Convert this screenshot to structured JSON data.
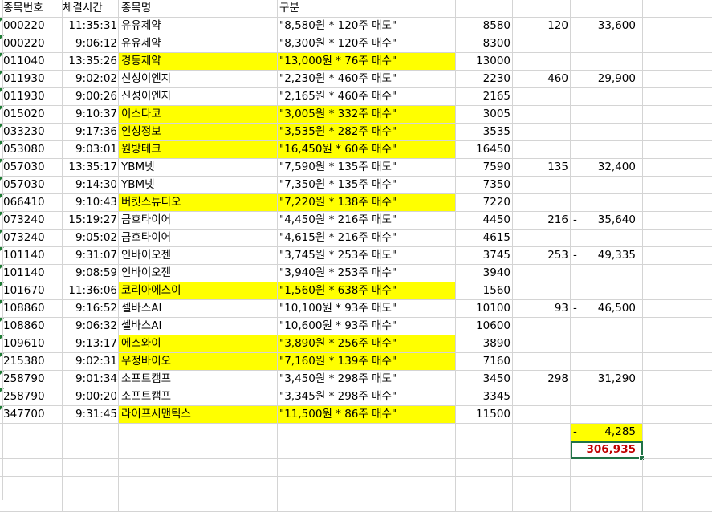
{
  "headers": [
    "종목번호",
    "체결시간",
    "종목명",
    "구분"
  ],
  "rows": [
    {
      "code": "000220",
      "time": "11:35:31",
      "name": "유유제약",
      "desc": "\"8,580원 * 120주 매도\"",
      "price": "8580",
      "qty": "120",
      "amount": "33,600",
      "neg": false,
      "hl": false
    },
    {
      "code": "000220",
      "time": "9:06:12",
      "name": "유유제약",
      "desc": "\"8,300원 * 120주 매수\"",
      "price": "8300",
      "qty": "",
      "amount": "",
      "neg": false,
      "hl": false
    },
    {
      "code": "011040",
      "time": "13:35:26",
      "name": "경동제약",
      "desc": "\"13,000원 * 76주 매수\"",
      "price": "13000",
      "qty": "",
      "amount": "",
      "neg": false,
      "hl": true
    },
    {
      "code": "011930",
      "time": "9:02:02",
      "name": "신성이엔지",
      "desc": "\"2,230원 * 460주 매도\"",
      "price": "2230",
      "qty": "460",
      "amount": "29,900",
      "neg": false,
      "hl": false
    },
    {
      "code": "011930",
      "time": "9:00:26",
      "name": "신성이엔지",
      "desc": "\"2,165원 * 460주 매수\"",
      "price": "2165",
      "qty": "",
      "amount": "",
      "neg": false,
      "hl": false
    },
    {
      "code": "015020",
      "time": "9:10:37",
      "name": "이스타코",
      "desc": "\"3,005원 * 332주 매수\"",
      "price": "3005",
      "qty": "",
      "amount": "",
      "neg": false,
      "hl": true
    },
    {
      "code": "033230",
      "time": "9:17:36",
      "name": "인성정보",
      "desc": "\"3,535원 * 282주 매수\"",
      "price": "3535",
      "qty": "",
      "amount": "",
      "neg": false,
      "hl": true
    },
    {
      "code": "053080",
      "time": "9:03:01",
      "name": "원방테크",
      "desc": "\"16,450원 * 60주 매수\"",
      "price": "16450",
      "qty": "",
      "amount": "",
      "neg": false,
      "hl": true
    },
    {
      "code": "057030",
      "time": "13:35:17",
      "name": "YBM넷",
      "desc": "\"7,590원 * 135주 매도\"",
      "price": "7590",
      "qty": "135",
      "amount": "32,400",
      "neg": false,
      "hl": false
    },
    {
      "code": "057030",
      "time": "9:14:30",
      "name": "YBM넷",
      "desc": "\"7,350원 * 135주 매수\"",
      "price": "7350",
      "qty": "",
      "amount": "",
      "neg": false,
      "hl": false
    },
    {
      "code": "066410",
      "time": "9:10:43",
      "name": "버킷스튜디오",
      "desc": "\"7,220원 * 138주 매수\"",
      "price": "7220",
      "qty": "",
      "amount": "",
      "neg": false,
      "hl": true
    },
    {
      "code": "073240",
      "time": "15:19:27",
      "name": "금호타이어",
      "desc": "\"4,450원 * 216주 매도\"",
      "price": "4450",
      "qty": "216",
      "amount": "35,640",
      "neg": true,
      "hl": false
    },
    {
      "code": "073240",
      "time": "9:05:02",
      "name": "금호타이어",
      "desc": "\"4,615원 * 216주 매수\"",
      "price": "4615",
      "qty": "",
      "amount": "",
      "neg": false,
      "hl": false
    },
    {
      "code": "101140",
      "time": "9:31:07",
      "name": "인바이오젠",
      "desc": "\"3,745원 * 253주 매도\"",
      "price": "3745",
      "qty": "253",
      "amount": "49,335",
      "neg": true,
      "hl": false
    },
    {
      "code": "101140",
      "time": "9:08:59",
      "name": "인바이오젠",
      "desc": "\"3,940원 * 253주 매수\"",
      "price": "3940",
      "qty": "",
      "amount": "",
      "neg": false,
      "hl": false
    },
    {
      "code": "101670",
      "time": "11:36:06",
      "name": "코리아에스이",
      "desc": "\"1,560원 * 638주 매수\"",
      "price": "1560",
      "qty": "",
      "amount": "",
      "neg": false,
      "hl": true
    },
    {
      "code": "108860",
      "time": "9:16:52",
      "name": "셀바스AI",
      "desc": "\"10,100원 * 93주 매도\"",
      "price": "10100",
      "qty": "93",
      "amount": "46,500",
      "neg": true,
      "hl": false
    },
    {
      "code": "108860",
      "time": "9:06:32",
      "name": "셀바스AI",
      "desc": "\"10,600원 * 93주 매수\"",
      "price": "10600",
      "qty": "",
      "amount": "",
      "neg": false,
      "hl": false
    },
    {
      "code": "109610",
      "time": "9:13:17",
      "name": "에스와이",
      "desc": "\"3,890원 * 256주 매수\"",
      "price": "3890",
      "qty": "",
      "amount": "",
      "neg": false,
      "hl": true
    },
    {
      "code": "215380",
      "time": "9:02:31",
      "name": "우정바이오",
      "desc": "\"7,160원 * 139주 매수\"",
      "price": "7160",
      "qty": "",
      "amount": "",
      "neg": false,
      "hl": true
    },
    {
      "code": "258790",
      "time": "9:01:34",
      "name": "소프트캠프",
      "desc": "\"3,450원 * 298주 매도\"",
      "price": "3450",
      "qty": "298",
      "amount": "31,290",
      "neg": false,
      "hl": false
    },
    {
      "code": "258790",
      "time": "9:00:20",
      "name": "소프트캠프",
      "desc": "\"3,345원 * 298주 매수\"",
      "price": "3345",
      "qty": "",
      "amount": "",
      "neg": false,
      "hl": false
    },
    {
      "code": "347700",
      "time": "9:31:45",
      "name": "라이프시맨틱스",
      "desc": "\"11,500원 * 86주 매수\"",
      "price": "11500",
      "qty": "",
      "amount": "",
      "neg": false,
      "hl": true
    }
  ],
  "summary": {
    "dash": "-",
    "subtotal": "4,285",
    "total": "306,935"
  },
  "colors": {
    "highlight": "#ffff00",
    "total_text": "#c00000",
    "selection": "#217346"
  }
}
